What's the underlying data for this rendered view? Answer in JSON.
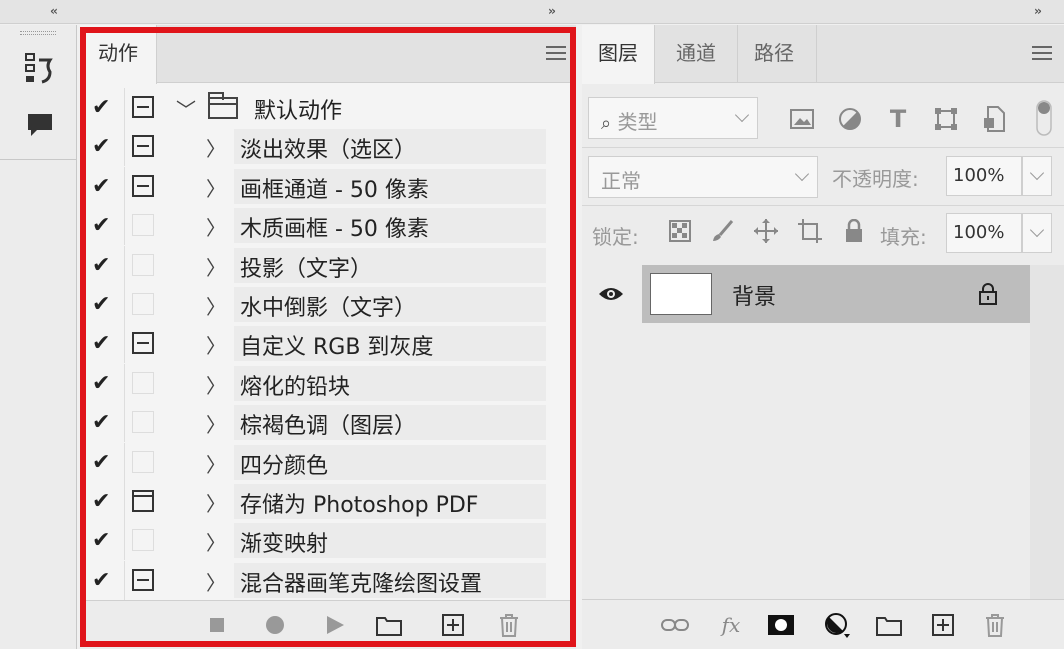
{
  "topbar": {
    "collapse_left": "‹‹",
    "expand_mid": "››",
    "expand_right": "››"
  },
  "actions_panel": {
    "tab_label": "动作",
    "set": {
      "name": "默认动作"
    },
    "items": [
      {
        "name": "淡出效果（选区）",
        "dialog": "on"
      },
      {
        "name": "画框通道 - 50 像素",
        "dialog": "on"
      },
      {
        "name": "木质画框 - 50 像素",
        "dialog": "off"
      },
      {
        "name": "投影（文字）",
        "dialog": "off"
      },
      {
        "name": "水中倒影（文字）",
        "dialog": "off"
      },
      {
        "name": "自定义 RGB 到灰度",
        "dialog": "on"
      },
      {
        "name": "熔化的铅块",
        "dialog": "off"
      },
      {
        "name": "棕褐色调（图层）",
        "dialog": "off"
      },
      {
        "name": "四分颜色",
        "dialog": "off"
      },
      {
        "name": "存储为 Photoshop PDF",
        "dialog": "box"
      },
      {
        "name": "渐变映射",
        "dialog": "off"
      },
      {
        "name": "混合器画笔克隆绘图设置",
        "dialog": "on"
      }
    ],
    "check_glyph": "✔",
    "expand_glyph": "〉",
    "collapse_glyph": "﹀"
  },
  "layers_panel": {
    "tabs": [
      "图层",
      "通道",
      "路径"
    ],
    "filter": {
      "label": "类型"
    },
    "blend_mode": "正常",
    "opacity": {
      "label": "不透明度:",
      "value": "100%"
    },
    "lock": {
      "label": "锁定:"
    },
    "fill": {
      "label": "填充:",
      "value": "100%"
    },
    "layers": [
      {
        "name": "背景",
        "visible": true,
        "locked": true
      }
    ]
  },
  "colors": {
    "highlight": "#e0141a",
    "panel_bg": "#ececec",
    "selected_layer": "#bdbdbd"
  }
}
